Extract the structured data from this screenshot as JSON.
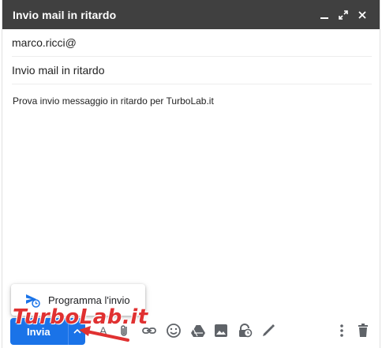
{
  "compose": {
    "title": "Invio mail in ritardo",
    "to": "marco.ricci@",
    "subject": "Invio mail in ritardo",
    "body": "Prova invio messaggio in ritardo per TurboLab.it"
  },
  "header_icons": [
    "minimize-icon",
    "expand-icon",
    "close-icon"
  ],
  "send": {
    "label": "Invia"
  },
  "popup": {
    "label": "Programma l'invio",
    "icon": "schedule-send-icon"
  },
  "toolbar_icons": [
    "format-text-icon",
    "attach-icon",
    "link-icon",
    "emoji-icon",
    "drive-icon",
    "photo-icon",
    "confidential-icon",
    "signature-icon",
    "more-options-icon",
    "trash-icon"
  ],
  "watermark": "TurboLab.it",
  "colors": {
    "header": "#404040",
    "send_button": "#1a73e8",
    "watermark": "#e03131",
    "arrow": "#e03131"
  }
}
